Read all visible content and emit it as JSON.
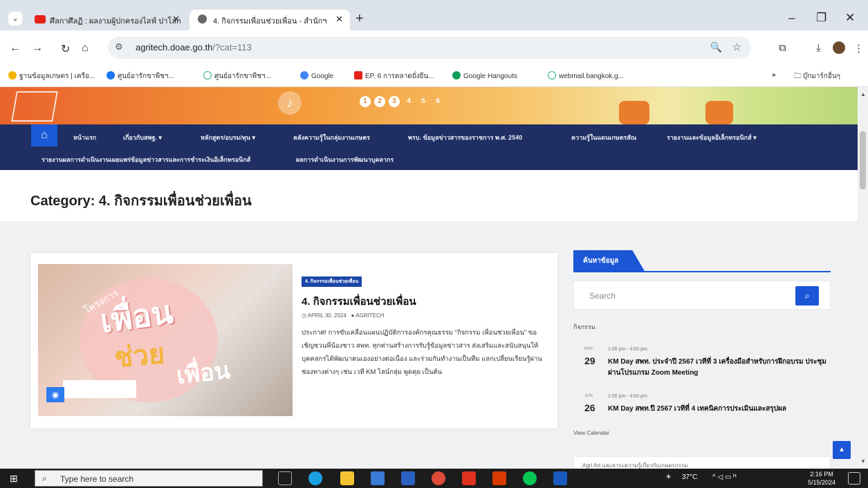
{
  "browser": {
    "tabs": [
      {
        "title": "ศึลกาศึลฏิ : ผลงามผู้ปกครองไลฟ์ ปาโลก",
        "icon": "youtube-icon",
        "color": "#e62117"
      },
      {
        "title": "4. กิจกรรมเพื่อนช่วยเพื่อน - สำนักฯ",
        "icon": "globe-icon",
        "color": "#555555"
      }
    ],
    "url_host": "agritech.doae.go.th",
    "url_path": "/?cat=113",
    "bookmarks": [
      "ฐานข้อมูลเกษตร | เครือ...",
      "ศูนย์อารักขาพืชฯ...",
      "ศูนย์อารักขาพืชฯ...",
      "Google",
      "EP. 6 การตลาดยั่งยืน...",
      "Google Hangouts",
      "webmail.bangkok.g..."
    ],
    "other_bookmarks": "บุ๊กมาร์กอื่นๆ"
  },
  "banner": {
    "dots": [
      "1",
      "2",
      "3",
      "4",
      "5",
      "6"
    ]
  },
  "nav": {
    "row1": [
      "หน้าแรก",
      "เกี่ยวกับสพฐ. ▾",
      "หลักสูตร/อบรม/ทุน ▾",
      "คลังความรู้ในกลุ่มงานเกษตร",
      "พรบ. ข้อมูลข่าวสารของราชการ พ.ศ. 2540",
      "ความรู้ในแดนเกษตรสัณ",
      "รายงานและข้อมูลอิเล็กทรอนิกส์ ▾"
    ],
    "row2": [
      "รายงานผลการดำเนินงานเผยแพร่ข้อมูลข่าวสารและการชำระเงินอิเล็กทรอนิกส์",
      "ผลการดำเนินงานการพัฒนาบุคลากร"
    ]
  },
  "category_title": "Category: 4. กิจกรรมเพื่อนช่วยเพื่อน",
  "post": {
    "badge": "4. กิจกรรมเพื่อนช่วยเพื่อน",
    "title": "4. กิจกรรมเพื่อนช่วยเพื่อน",
    "date": "APRIL 30, 2024",
    "author": "AGRITECH",
    "excerpt": "ประกาศ! การขับเคลื่อนแผนปฏิบัติการองค์กรคุณธรรม \"กิจกรรม เพื่อนช่วยเพื่อน\" ขอเชิญชวนพี่น้องชาว สพท. ทุกท่านสร้างการรับรู้ข้อมูลข่าวสาร ส่งเสริมและสนับสนุนให้บุคคลกรได้พัฒนาตนเองอย่างต่อเนื่อง และร่วมกันทำงานเป็นทีม แลกเปลี่ยนเรียนรู้ผ่านช่องทางต่างๆ เช่น เวที KM ไลน์กลุ่ม พูดคุย เป็นต้น",
    "image_text": [
      "เพื่อน",
      "ช่วย",
      "เพื่อน"
    ],
    "image_tag": "โครงการ"
  },
  "sidebar": {
    "tab": "ค้นหาข้อมูล",
    "search_placeholder": "Search",
    "events_label": "กิจกรรม",
    "events": [
      {
        "month": "MAY",
        "day": "29",
        "time": "1:00 pm - 4:00 pm",
        "title": "KM Day สพท. ประจำปี 2567 เวทีที่ 3 เครื่องมือสำหรับการฝึกอบรม ประชุม ผ่านโปรแกรม Zoom Meeting"
      },
      {
        "month": "JUN",
        "day": "26",
        "time": "1:00 pm - 4:00 pm",
        "title": "KM Day สพท.ปี 2567 เวทีที่ 4 เทคนิคการประเมินและสรุปผล"
      }
    ],
    "view_calendar": "View Calendar",
    "next_card": "Agri Art และสาระความรู้เกี่ยวกับเกษตรกรรม"
  },
  "taskbar": {
    "search_placeholder": "Type here to search",
    "temperature": "37°C",
    "time": "2:16 PM",
    "date": "5/15/2024"
  }
}
